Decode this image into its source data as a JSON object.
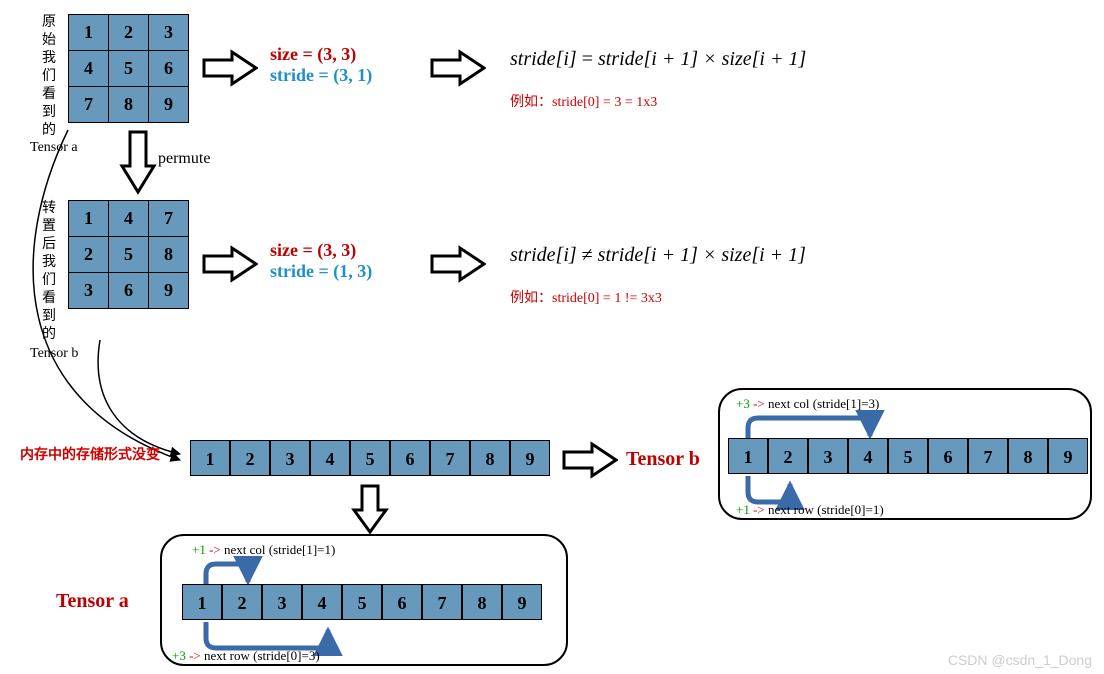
{
  "labels": {
    "vlabel_a": "原始我们看到的",
    "vlabel_b": "转置后我们看到的",
    "tensor_a_cap": "Tensor a",
    "tensor_b_cap": "Tensor b",
    "permute": "permute",
    "mem_note": "内存中的存储形式没变",
    "tensor_a": "Tensor a",
    "tensor_b": "Tensor b",
    "watermark": "CSDN @csdn_1_Dong"
  },
  "block_a": {
    "size_label": "size = (3, 3)",
    "stride_label": "stride = (3, 1)",
    "formula_lhs": "stride[i]",
    "formula_op": " = ",
    "formula_rhs": "stride[i + 1] × size[i + 1]",
    "example": "例如：stride[0] = 3 = 1x3"
  },
  "block_b": {
    "size_label": "size = (3, 3)",
    "stride_label": "stride = (1, 3)",
    "formula_lhs": "stride[i]",
    "formula_op": "  ≠  ",
    "formula_rhs": "stride[i + 1] × size[i + 1]",
    "example": "例如：stride[0] = 1 != 3x3"
  },
  "box_a": {
    "top_plus": "+1 ",
    "top_arrow": "-> ",
    "top_text": "next col (stride[1]=1)",
    "bot_plus": "+3 ",
    "bot_arrow": "-> ",
    "bot_text": "next row (stride[0]=3)"
  },
  "box_b": {
    "top_plus": "+3 ",
    "top_arrow": "-> ",
    "top_text": "next col (stride[1]=3)",
    "bot_plus": "+1 ",
    "bot_arrow": "-> ",
    "bot_text": "next row (stride[0]=1)"
  },
  "chart_data": {
    "type": "table",
    "matrix_a": [
      [
        1,
        2,
        3
      ],
      [
        4,
        5,
        6
      ],
      [
        7,
        8,
        9
      ]
    ],
    "matrix_b": [
      [
        1,
        4,
        7
      ],
      [
        2,
        5,
        8
      ],
      [
        3,
        6,
        9
      ]
    ],
    "memory_layout": [
      1,
      2,
      3,
      4,
      5,
      6,
      7,
      8,
      9
    ],
    "tensor_a_box_layout": [
      1,
      2,
      3,
      4,
      5,
      6,
      7,
      8,
      9
    ],
    "tensor_b_box_layout": [
      1,
      2,
      3,
      4,
      5,
      6,
      7,
      8,
      9
    ]
  }
}
